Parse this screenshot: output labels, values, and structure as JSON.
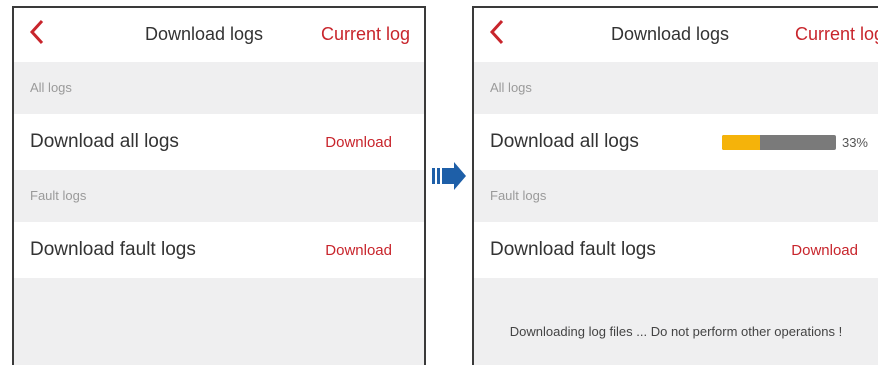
{
  "colors": {
    "accent": "#c8252c",
    "progress_fill": "#f5b30a",
    "progress_track": "#7a7a7a",
    "arrow": "#1e5fa8"
  },
  "left": {
    "header": {
      "title": "Download logs",
      "link": "Current log"
    },
    "sections": [
      {
        "label": "All logs",
        "row_label": "Download all logs",
        "action": "Download"
      },
      {
        "label": "Fault logs",
        "row_label": "Download fault logs",
        "action": "Download"
      }
    ]
  },
  "right": {
    "header": {
      "title": "Download logs",
      "link": "Current log"
    },
    "sections": [
      {
        "label": "All logs",
        "row_label": "Download all logs",
        "progress_percent": 33,
        "progress_text": "33%"
      },
      {
        "label": "Fault logs",
        "row_label": "Download fault logs",
        "action": "Download"
      }
    ],
    "status_message": "Downloading log files ... Do not perform other operations !"
  },
  "icons": {
    "back": "chevron-left-icon",
    "transition": "arrow-right-icon"
  }
}
